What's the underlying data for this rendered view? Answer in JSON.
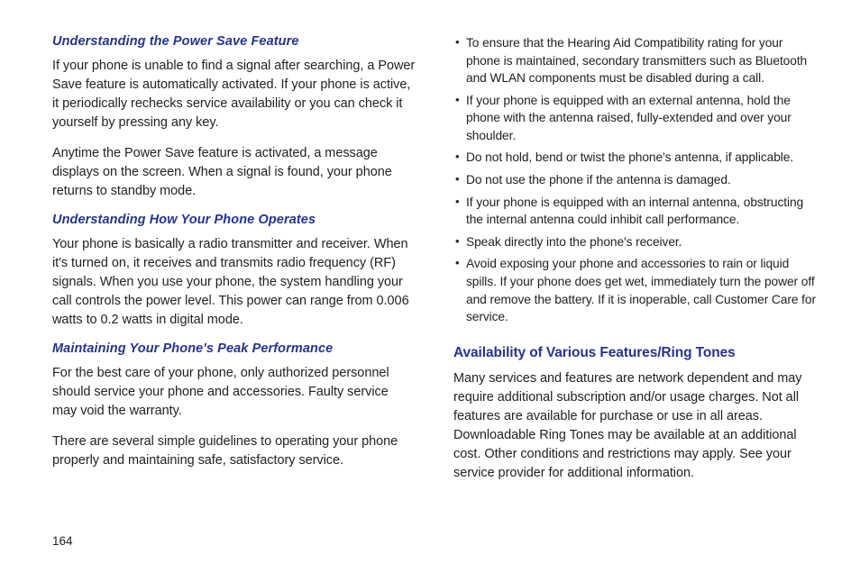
{
  "pageNumber": "164",
  "left": {
    "s1": {
      "head": "Understanding the Power Save Feature",
      "p1": "If your phone is unable to find a signal after searching, a Power Save feature is automatically activated. If your phone is active, it periodically rechecks service availability or you can check it yourself by pressing any key.",
      "p2": "Anytime the Power Save feature is activated, a message displays on the screen. When a signal is found, your phone returns to standby mode."
    },
    "s2": {
      "head": "Understanding How Your Phone Operates",
      "p1": "Your phone is basically a radio transmitter and receiver. When it's turned on, it receives and transmits radio frequency (RF) signals. When you use your phone, the system handling your call controls the power level. This power can range from 0.006 watts to 0.2 watts in digital mode."
    },
    "s3": {
      "head": "Maintaining Your Phone's Peak Performance",
      "p1": "For the best care of your phone, only authorized personnel should service your phone and accessories. Faulty service may void the warranty.",
      "p2": "There are several simple guidelines to operating your phone properly and maintaining safe, satisfactory service."
    }
  },
  "right": {
    "bullets": [
      "To ensure that the Hearing Aid Compatibility rating for your phone is maintained, secondary transmitters such as Bluetooth and WLAN components must be disabled during a call.",
      "If your phone is equipped with an external antenna, hold the phone with the antenna raised, fully-extended and over your shoulder.",
      "Do not hold, bend or twist the phone's antenna, if applicable.",
      "Do not use the phone if the antenna is damaged.",
      "If your phone is equipped with an internal antenna, obstructing the internal antenna could inhibit call performance.",
      "Speak directly into the phone's receiver.",
      "Avoid exposing your phone and accessories to rain or liquid spills. If your phone does get wet, immediately turn the power off and remove the battery. If it is inoperable, call Customer Care for service."
    ],
    "h2": "Availability of Various Features/Ring Tones",
    "p1": "Many services and features are network dependent and may require additional subscription and/or usage charges. Not all features are available for purchase or use in all areas. Downloadable Ring Tones may be available at an additional cost. Other conditions and restrictions may apply. See your service provider for additional information."
  }
}
